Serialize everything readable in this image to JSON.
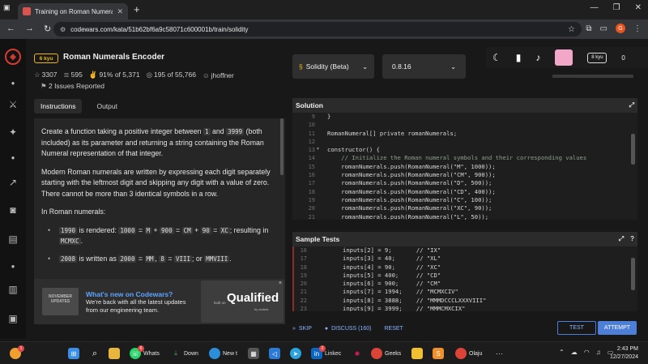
{
  "browser": {
    "tab_title": "Training on Roman Numerals Enc",
    "url": "codewars.com/kata/51b62bf6a9c58071c600001b/train/solidity",
    "profile_initial": "G"
  },
  "kata": {
    "rank": "6 kyu",
    "title": "Roman Numerals Encoder",
    "stats": {
      "stars": "3307",
      "collections": "595",
      "satisfaction": "91% of 5,371",
      "completed": "195 of 55,766",
      "author": "jhoffner"
    },
    "issues": "2 Issues Reported"
  },
  "tabs": {
    "instructions": "Instructions",
    "output": "Output"
  },
  "instructions": {
    "p1_a": "Create a function taking a positive integer between ",
    "p1_c1": "1",
    "p1_b": " and ",
    "p1_c2": "3999",
    "p1_d": " (both included) as its parameter and returning a string containing the Roman Numeral representation of that integer.",
    "p2": "Modern Roman numerals are written by expressing each digit separately starting with the leftmost digit and skipping any digit with a value of zero. There cannot be more than 3 identical symbols in a row.",
    "p3": "In Roman numerals:",
    "b1_c1": "1990",
    "b1_t1": " is rendered: ",
    "b1_c2": "1000",
    "b1_t2": " = ",
    "b1_c3": "M",
    "b1_t3": " + ",
    "b1_c4": "900",
    "b1_t4": " = ",
    "b1_c5": "CM",
    "b1_t5": " + ",
    "b1_c6": "90",
    "b1_t6": " = ",
    "b1_c7": "XC",
    "b1_t7": "; resulting in ",
    "b1_c8": "MCMXC",
    "b1_t8": ".",
    "b2_c1": "2008",
    "b2_t1": " is written as ",
    "b2_c2": "2000",
    "b2_t2": " = ",
    "b2_c3": "MM",
    "b2_t3": ", ",
    "b2_c4": "8",
    "b2_t4": " = ",
    "b2_c5": "VIII",
    "b2_t5": "; or ",
    "b2_c6": "MMVIII",
    "b2_t6": "."
  },
  "promo": {
    "thumb_text": "NOVEMBER UPDATES",
    "title": "What's new on Codewars?",
    "body": "We're back with all the latest updates from our engineering team.",
    "built_on": "built on",
    "brand": "Qualified",
    "brand_sub": "by andela"
  },
  "language": {
    "name": "Solidity (Beta)",
    "version": "0.8.16"
  },
  "user": {
    "rank": "8 kyu",
    "honor": "0"
  },
  "solution": {
    "header": "Solution",
    "line_numbers": [
      "9",
      "10",
      "11",
      "12",
      "13",
      "14",
      "15",
      "16",
      "17",
      "18",
      "19",
      "20",
      "21"
    ],
    "lines": [
      "}",
      "",
      "RomanNumeral[] private romanNumerals;",
      "",
      "constructor() {",
      "    // Initialize the Roman numeral symbols and their corresponding values",
      "    romanNumerals.push(RomanNumeral(\"M\", 1000));",
      "    romanNumerals.push(RomanNumeral(\"CM\", 900));",
      "    romanNumerals.push(RomanNumeral(\"D\", 500));",
      "    romanNumerals.push(RomanNumeral(\"CD\", 400));",
      "    romanNumerals.push(RomanNumeral(\"C\", 100));",
      "    romanNumerals.push(RomanNumeral(\"XC\", 90));",
      "    romanNumerals.push(RomanNumeral(\"L\", 50));"
    ]
  },
  "sample_tests": {
    "header": "Sample Tests",
    "line_numbers": [
      "16",
      "17",
      "18",
      "19",
      "20",
      "21",
      "22",
      "23"
    ],
    "lines": [
      "inputs[2] = 9;       // \"IX\"",
      "inputs[3] = 40;      // \"XL\"",
      "inputs[4] = 90;      // \"XC\"",
      "inputs[5] = 400;     // \"CD\"",
      "inputs[6] = 900;     // \"CM\"",
      "inputs[7] = 1994;    // \"MCMXCIV\"",
      "inputs[8] = 3888;    // \"MMMDCCCLXXXVIII\"",
      "inputs[9] = 3999;    // \"MMMCMXCIX\""
    ]
  },
  "actions": {
    "skip": "SKIP",
    "discuss": "DISCUSS (160)",
    "reset": "RESET",
    "test": "TEST",
    "attempt": "ATTEMPT"
  },
  "taskbar": {
    "whatsapp": "Whats",
    "whatsapp_badge": "6",
    "downloads": "Down",
    "edge": "New t",
    "linkedin": "Linkec",
    "linkedin_badge": "2",
    "chrome": "Geeks",
    "chrome2": "Olaju",
    "weather_badge": "1",
    "time": "2:43 PM",
    "date": "12/27/2024"
  }
}
